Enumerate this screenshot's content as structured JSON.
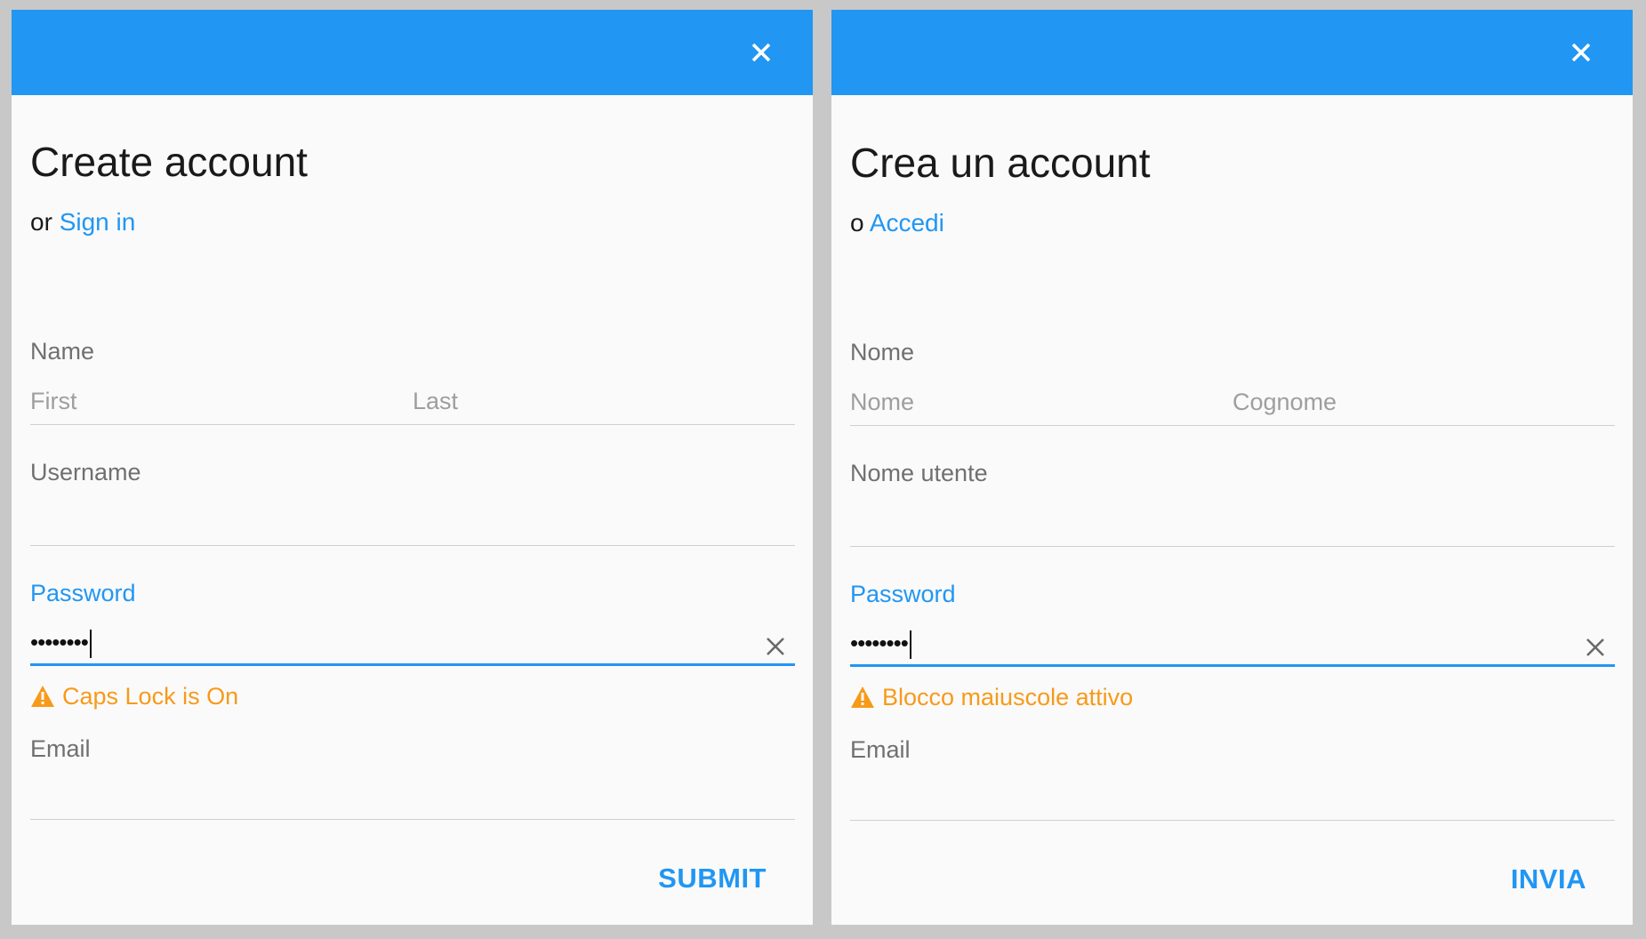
{
  "colors": {
    "primary": "#2196f3",
    "warning": "#f79a19",
    "background": "#fafafa",
    "frame": "#c8c8c8"
  },
  "panels": [
    {
      "language": "en",
      "close_icon": "close-icon",
      "title": "Create account",
      "alt_prefix": "or",
      "alt_link": "Sign in",
      "name_label": "Name",
      "first_placeholder": "First",
      "last_placeholder": "Last",
      "username_label": "Username",
      "password_label": "Password",
      "password_value": "••••••••",
      "caps_warning": "Caps Lock is On",
      "email_label": "Email",
      "submit_label": "SUBMIT"
    },
    {
      "language": "it",
      "close_icon": "close-icon",
      "title": "Crea un account",
      "alt_prefix": "o",
      "alt_link": "Accedi",
      "name_label": "Nome",
      "first_placeholder": "Nome",
      "last_placeholder": "Cognome",
      "username_label": "Nome utente",
      "password_label": "Password",
      "password_value": "••••••••",
      "caps_warning": "Blocco maiuscole attivo",
      "email_label": "Email",
      "submit_label": "INVIA"
    }
  ]
}
